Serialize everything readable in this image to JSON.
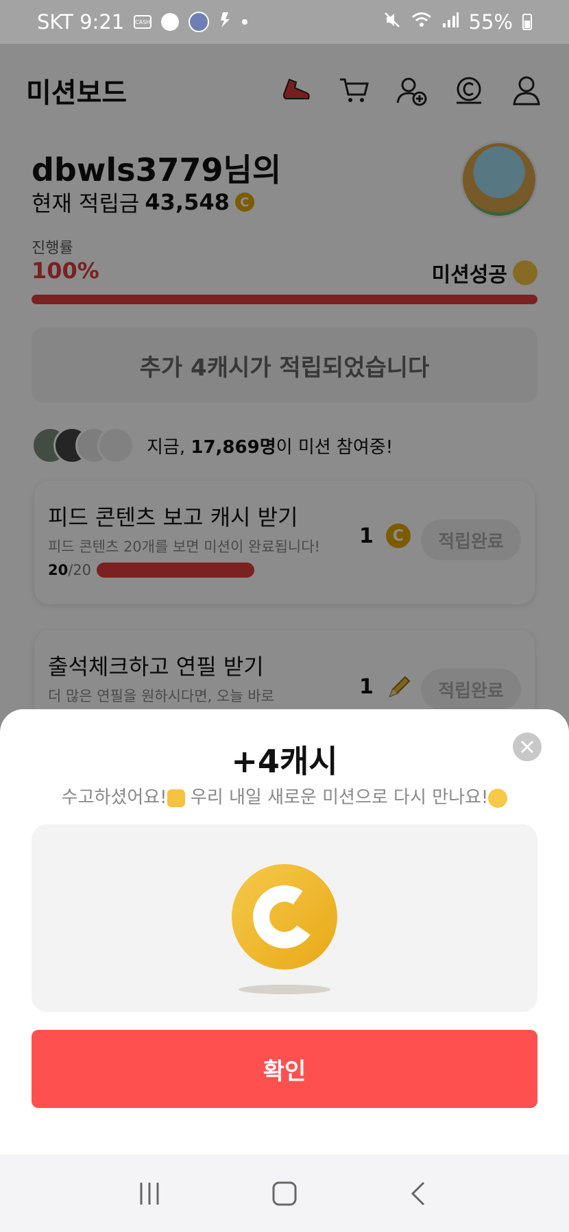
{
  "status_bar": {
    "carrier_time": "SKT 9:21",
    "battery": "55%"
  },
  "header": {
    "title": "미션보드"
  },
  "user": {
    "greeting": "dbwls3779님의",
    "balance_label": "현재 적립금",
    "balance_value": "43,548",
    "coin_symbol": "C"
  },
  "progress": {
    "label": "진행률",
    "percent_text": "100%",
    "value": 1.0,
    "status": "미션성공"
  },
  "notice": {
    "text": "추가 4캐시가 적립되었습니다"
  },
  "participants": {
    "prefix": "지금, ",
    "count": "17,869명",
    "suffix": "이 미션 참여중!"
  },
  "missions": [
    {
      "title": "피드 콘텐츠 보고 캐시 받기",
      "subtitle": "피드 콘텐츠 20개를 보면 미션이 완료됩니다!",
      "count_done": "20",
      "count_total": "/20",
      "reward": "1",
      "reward_icon": "coin-icon",
      "button": "적립완료"
    },
    {
      "title": "출석체크하고 연필 받기",
      "subtitle": "더 많은 연필을 원하시다면, 오늘 바로",
      "reward": "1",
      "reward_icon": "pencil-icon",
      "button": "적립완료"
    }
  ],
  "sheet": {
    "title": "+4캐시",
    "message_part1": "수고하셨어요!",
    "message_part2": " 우리 내일 새로운 미션으로 다시 만나요!",
    "confirm": "확인"
  },
  "colors": {
    "accent": "#ff5050",
    "progress": "#e03c3c",
    "coin": "#e9a918"
  }
}
